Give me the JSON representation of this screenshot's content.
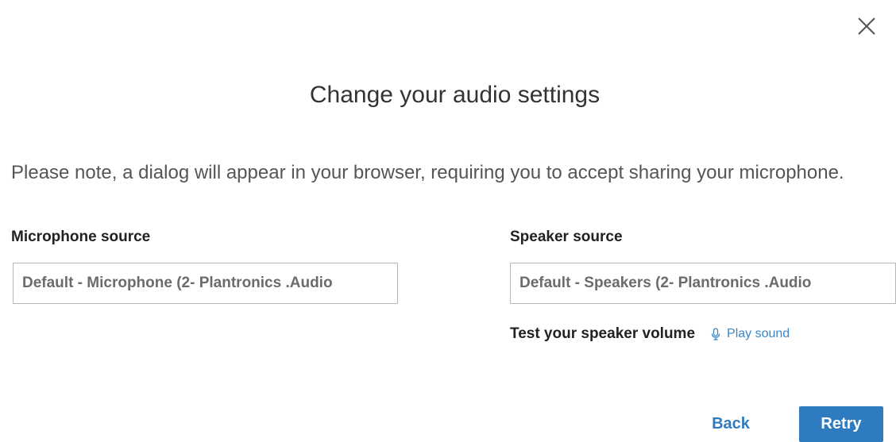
{
  "dialog": {
    "title": "Change your audio settings",
    "note": "Please note, a dialog will appear in your browser, requiring you to accept sharing your microphone.",
    "close_icon": "close-icon"
  },
  "microphone": {
    "label": "Microphone source",
    "selected": "Default - Microphone (2- Plantronics .Audio"
  },
  "speaker": {
    "label": "Speaker source",
    "selected": "Default - Speakers (2- Plantronics .Audio",
    "test_label": "Test your speaker volume",
    "play_label": "Play sound",
    "play_icon": "microphone-icon"
  },
  "actions": {
    "back_label": "Back",
    "retry_label": "Retry"
  },
  "colors": {
    "accent": "#2f7bbf",
    "link": "#3a86c8",
    "text": "#333333"
  }
}
